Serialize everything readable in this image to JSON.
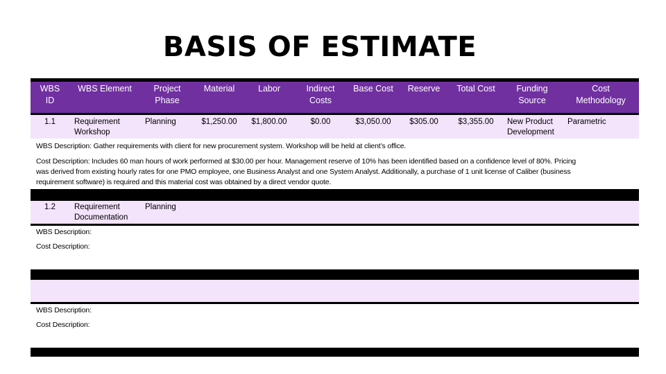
{
  "title": "BASIS OF ESTIMATE",
  "colors": {
    "header_bg": "#7030A0",
    "row_bg": "#F3E3FB",
    "separator": "#000000",
    "header_text": "#FFFFFF"
  },
  "table": {
    "headers": {
      "wbs_id": [
        "WBS",
        "ID"
      ],
      "wbs_element": [
        "WBS Element"
      ],
      "project_phase": [
        "Project",
        "Phase"
      ],
      "material": [
        "Material"
      ],
      "labor": [
        "Labor"
      ],
      "indirect_costs": [
        "Indirect",
        "Costs"
      ],
      "base_cost": [
        "Base Cost"
      ],
      "reserve": [
        "Reserve"
      ],
      "total_cost": [
        "Total Cost"
      ],
      "funding_source": [
        "Funding",
        "Source"
      ],
      "cost_methodology": [
        "Cost",
        "Methodology"
      ]
    },
    "rows": [
      {
        "wbs_id": "1.1",
        "wbs_element": [
          "Requirement",
          "Workshop"
        ],
        "project_phase": "Planning",
        "material": "$1,250.00",
        "labor": "$1,800.00",
        "indirect_costs": "$0.00",
        "base_cost": "$3,050.00",
        "reserve": "$305.00",
        "total_cost": "$3,355.00",
        "funding_source": [
          "New Product",
          "Development"
        ],
        "cost_methodology": "Parametric",
        "wbs_description": "WBS Description: Gather requirements with client for new procurement system.  Workshop will be held at client’s office.",
        "cost_description": [
          "Cost Description: Includes 60 man hours of work performed at $30.00 per hour.   Management reserve of 10% has been identified based on a confidence level of 80%.  Pricing",
          "was derived from existing hourly rates for one PMO employee,  one Business Analyst and one System Analyst. Additionally,  a purchase of 1 unit license of Caliber (business",
          "requirement software) is required and this material cost was obtained by  a direct vendor quote."
        ]
      },
      {
        "wbs_id": "1.2",
        "wbs_element": [
          "Requirement",
          "Documentation"
        ],
        "project_phase": "Planning",
        "wbs_description": "WBS Description:",
        "cost_description": [
          "Cost Description:"
        ]
      },
      {
        "wbs_description": "WBS Description:",
        "cost_description": [
          "Cost Description:"
        ]
      }
    ]
  }
}
